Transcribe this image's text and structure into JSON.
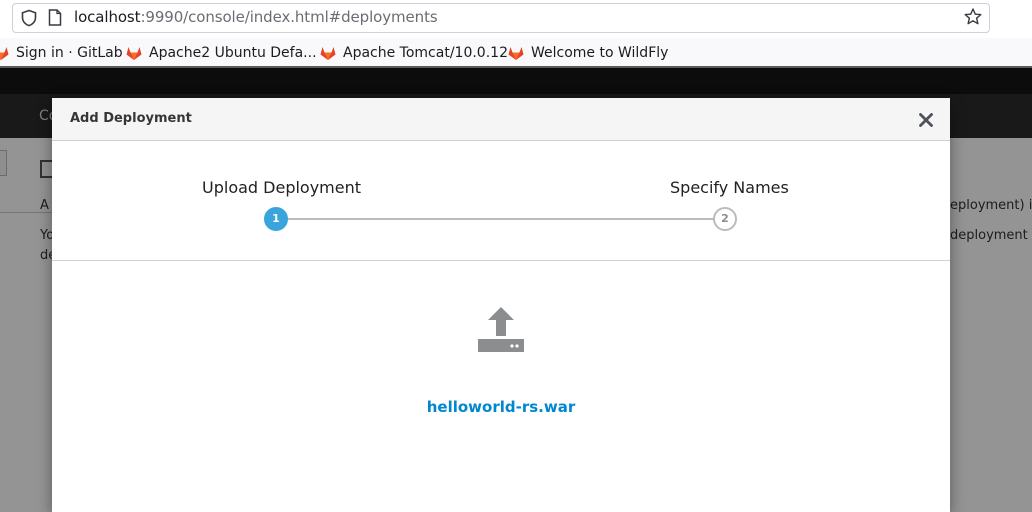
{
  "browser": {
    "url_host": "localhost",
    "url_rest": ":9990/console/index.html#deployments",
    "bookmarks": [
      {
        "label": "Sign in · GitLab",
        "icon": "gitlab-fox-icon"
      },
      {
        "label": "Apache2 Ubuntu Defa...",
        "icon": "gitlab-fox-icon"
      },
      {
        "label": "Apache Tomcat/10.0.12",
        "icon": "gitlab-fox-icon"
      },
      {
        "label": "Welcome to WildFly",
        "icon": "gitlab-fox-icon"
      }
    ]
  },
  "console": {
    "nav_fragment": "Co",
    "text_fragments": [
      "A",
      "Yo",
      "de",
      "eployment) int",
      "deployment wi"
    ]
  },
  "dialog": {
    "title": "Add Deployment",
    "close_icon": "close-icon",
    "steps": [
      {
        "label": "Upload Deployment",
        "number": "1",
        "state": "active"
      },
      {
        "label": "Specify Names",
        "number": "2",
        "state": "inactive"
      }
    ],
    "upload_icon": "upload-icon",
    "file_name": "helloworld-rs.war"
  },
  "colors": {
    "accent": "#39a5dc",
    "link": "#0088ce",
    "gitlab_orange": "#e24329"
  }
}
